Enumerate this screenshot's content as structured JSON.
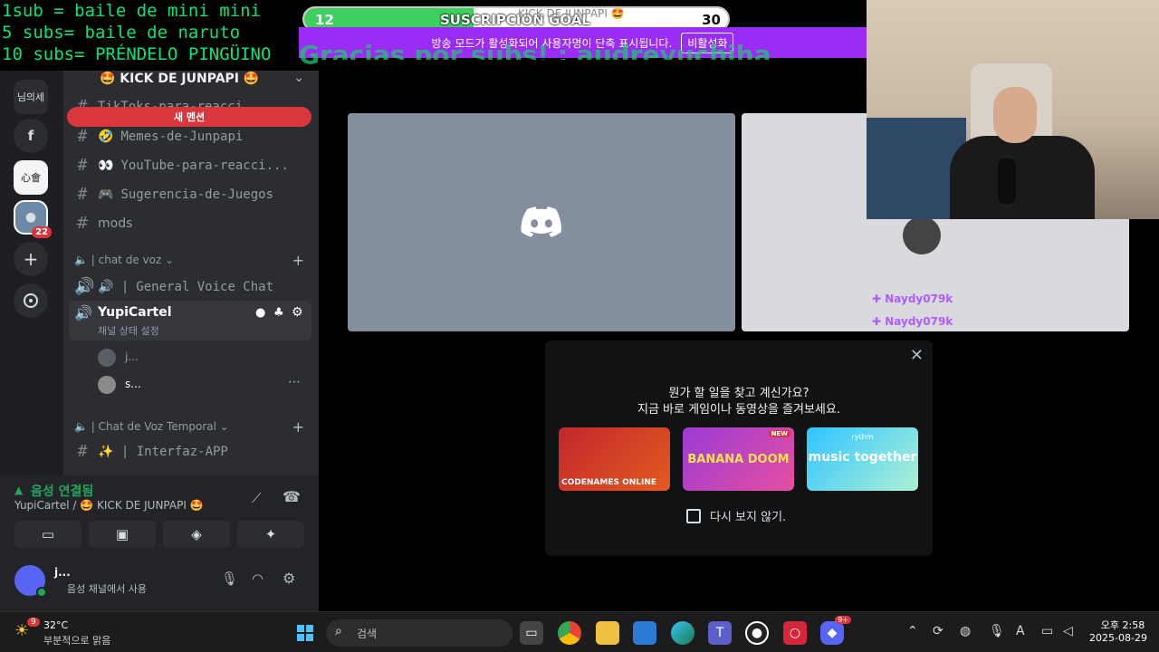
{
  "overlay": {
    "rules": [
      "1sub = baile de mini mini",
      "5 subs= baile de naruto",
      "10 subs= PRÉNDELO PINGÜINO"
    ],
    "thanks": "Gracias por subs! : audreyuchiha",
    "goal_current": "12",
    "goal_title": "SUSCRIPCION GOAL",
    "goal_target": "30",
    "goal_progress": 0.4,
    "stream_title": "KICK DE JUNPAPI 🤩",
    "broadcast_notice": "방송 모드가 활성화되어 사용자명이 단축 표시됩니다.",
    "broadcast_disable": "비활성화"
  },
  "rail": {
    "top_label": "님의세",
    "f_label": "f",
    "server_label": "心會",
    "badge": "22"
  },
  "server": {
    "name": "🤩 KICK DE JUNPAPI 🤩",
    "new_mention": "새 멘션",
    "cut_channel": "TikToks-para-reacci",
    "channels": [
      {
        "icon": "🤣",
        "label": "Memes-de-Junpapi"
      },
      {
        "icon": "👀",
        "label": "YouTube-para-reacci..."
      },
      {
        "icon": "🎮",
        "label": "Sugerencia-de-Juegos"
      },
      {
        "icon": "",
        "label": "mods"
      }
    ],
    "voice_category": "chat de voz",
    "general_voice": "General Voice Chat",
    "active_voice": "YupiCartel",
    "voice_status": "채널 상태 설정",
    "members": [
      "j...",
      "s..."
    ],
    "temp_category": "Chat de Voz Temporal",
    "interfaz": "✨ | Interfaz-APP"
  },
  "voice_panel": {
    "status": "음성 연결됨",
    "location": "YupiCartel / 🤩 KICK DE JUNPAPI 🤩",
    "username": "j...",
    "user_status": "음성 채널에서 사용"
  },
  "stage": {
    "names": [
      "Naydy079k",
      "Naydy079k"
    ],
    "prompt_line1": "뭔가 할 일을 찾고 계신가요?",
    "prompt_line2": "지금 바로 게임이나 동영상을 즐겨보세요.",
    "activities": [
      "CODENAMES ONLINE",
      "BANANA DOOM",
      "music together"
    ],
    "activity_new": "NEW",
    "activity_brand": "rythm",
    "dont_show": "다시 보지 않기."
  },
  "taskbar": {
    "weather_temp": "32°C",
    "weather_desc": "부분적으로 맑음",
    "weather_badge": "9",
    "search": "검색",
    "time": "오후 2:58",
    "date": "2025-08-29",
    "discord_badge": "9+"
  },
  "colors": {
    "accent": "#5865f2",
    "green": "#23a55a",
    "red": "#da373c",
    "overlay_green": "#00e676"
  }
}
